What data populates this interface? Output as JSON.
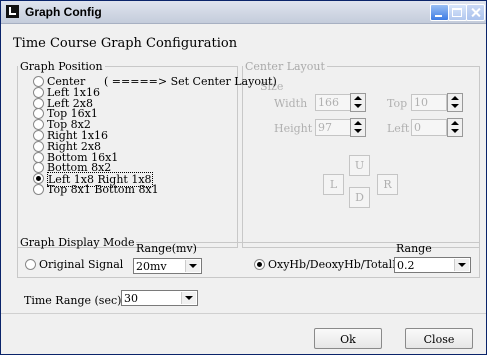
{
  "window": {
    "title": "Graph Config"
  },
  "heading": "Time Course Graph Configuration",
  "graph_position": {
    "legend": "Graph Position",
    "options": [
      {
        "label": "Center",
        "checked": false
      },
      {
        "label": "Left 1x16",
        "checked": false
      },
      {
        "label": "Left 2x8",
        "checked": false
      },
      {
        "label": "Top 16x1",
        "checked": false
      },
      {
        "label": "Top 8x2",
        "checked": false
      },
      {
        "label": "Right 1x16",
        "checked": false
      },
      {
        "label": "Right 2x8",
        "checked": false
      },
      {
        "label": "Bottom 16x1",
        "checked": false
      },
      {
        "label": "Bottom 8x2",
        "checked": false
      },
      {
        "label": "Left 1x8 Right 1x8",
        "checked": true
      },
      {
        "label": "Top 8x1 Bottom 8x1",
        "checked": false
      }
    ],
    "center_note": "( =====> Set Center Layout)"
  },
  "center_layout": {
    "legend": "Center Layout",
    "size_label": "Size",
    "width_label": "Width",
    "width_value": "166",
    "height_label": "Height",
    "height_value": "97",
    "top_label": "Top",
    "top_value": "10",
    "left_label": "Left",
    "left_value": "0",
    "btn_up": "U",
    "btn_left": "L",
    "btn_right": "R",
    "btn_down": "D"
  },
  "display_mode": {
    "legend": "Graph Display Mode",
    "original_label": "Original Signal",
    "original_checked": false,
    "range_mv_label": "Range(mv)",
    "range_mv_value": "20mv",
    "oxy_label": "OxyHb/DeoxyHb/TotalHb",
    "oxy_checked": true,
    "range_label": "Range",
    "range_value": "0.2"
  },
  "time_range": {
    "label": "Time Range (sec)",
    "value": "30"
  },
  "buttons": {
    "ok": "Ok",
    "close": "Close"
  }
}
